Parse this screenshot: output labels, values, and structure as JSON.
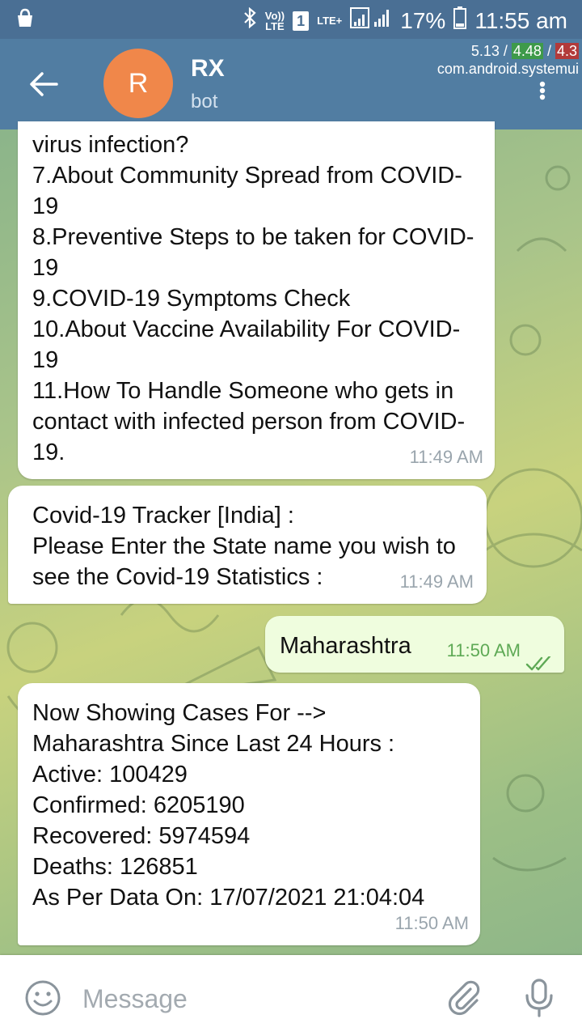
{
  "status_bar": {
    "volte_line1": "Vo))",
    "volte_line2": "LTE",
    "sim_number": "1",
    "lte_label": "LTE+",
    "battery_percent": "17%",
    "time": "11:55 am"
  },
  "overlay": {
    "load_1": "5.13",
    "load_2": "4.48",
    "load_3": "4.3",
    "sep": " / ",
    "process": "com.android.systemui"
  },
  "header": {
    "avatar_letter": "R",
    "avatar_color": "#f0874a",
    "title": "RX",
    "subtitle": "bot"
  },
  "messages": [
    {
      "direction": "incoming",
      "text": "virus infection?\n7.About Community Spread from COVID-19\n8.Preventive Steps to be taken for COVID-19\n9.COVID-19 Symptoms Check\n10.About Vaccine Availability For COVID-19\n11.How To Handle Someone who gets in contact with infected person from COVID-19.",
      "time": "11:49 AM"
    },
    {
      "direction": "incoming",
      "text": "Covid-19 Tracker [India] :\nPlease Enter the State name you wish to see the Covid-19 Statistics :",
      "time": "11:49 AM"
    },
    {
      "direction": "outgoing",
      "text": "Maharashtra",
      "time": "11:50 AM",
      "status": "read"
    },
    {
      "direction": "incoming",
      "text": "Now Showing Cases For -->\nMaharashtra Since Last 24 Hours :\nActive: 100429\nConfirmed: 6205190\nRecovered: 5974594\nDeaths: 126851\nAs Per Data On: 17/07/2021 21:04:04",
      "time": "11:50 AM"
    }
  ],
  "composer": {
    "placeholder": "Message"
  },
  "colors": {
    "header": "#517da2",
    "status_bar": "#4a6f94",
    "outgoing_bubble": "#effdde",
    "read_ticks": "#5ea955"
  }
}
